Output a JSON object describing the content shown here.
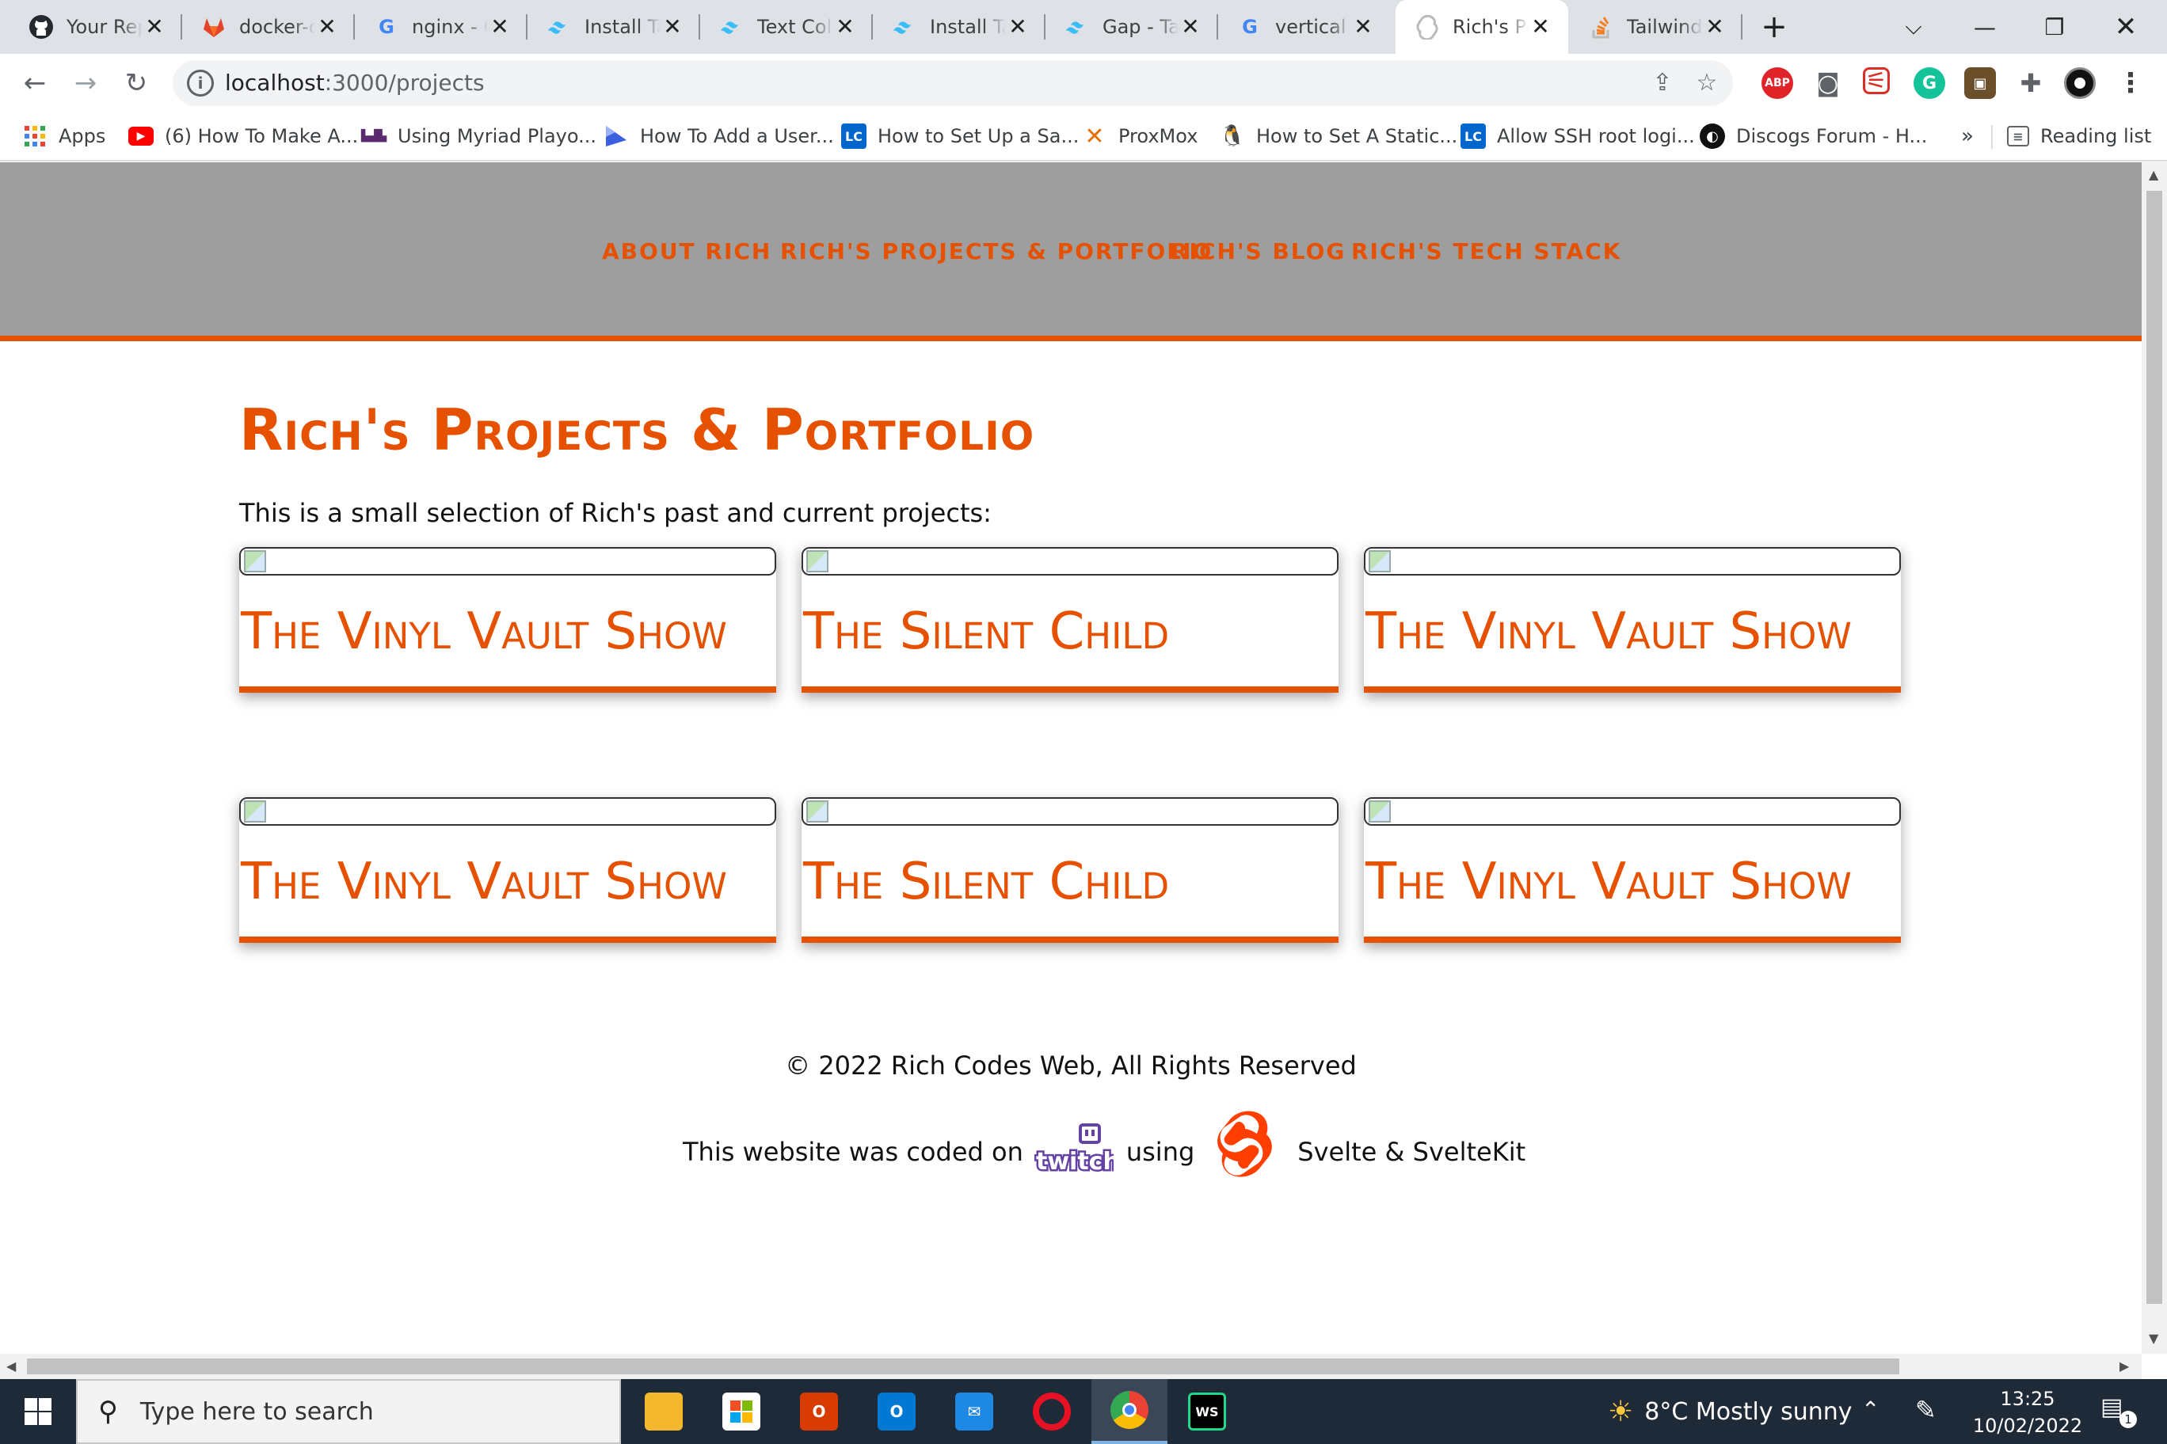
{
  "tabs": [
    {
      "title": "Your Repositories",
      "icon": "github-icon"
    },
    {
      "title": "docker-compose",
      "icon": "gitlab-icon"
    },
    {
      "title": "nginx - Google Search",
      "icon": "google-icon"
    },
    {
      "title": "Install Tailwind CSS",
      "icon": "tailwind-icon"
    },
    {
      "title": "Text Color - Tailwind CSS",
      "icon": "tailwind-icon"
    },
    {
      "title": "Install Tailwind CSS",
      "icon": "tailwind-icon"
    },
    {
      "title": "Gap - Tailwind CSS",
      "icon": "tailwind-icon"
    },
    {
      "title": "vertical align",
      "icon": "google-icon"
    },
    {
      "title": "Rich's Projects",
      "icon": "svelte-icon"
    },
    {
      "title": "Tailwind",
      "icon": "stackoverflow-icon"
    }
  ],
  "url": {
    "host": "localhost",
    "path": ":3000/projects"
  },
  "bookmarks": [
    {
      "label": "Apps",
      "icon": "apps-grid-icon"
    },
    {
      "label": "(6) How To Make A...",
      "icon": "youtube-icon"
    },
    {
      "label": "Using Myriad Playo...",
      "icon": "myriad-icon"
    },
    {
      "label": "How To Add a User...",
      "icon": "linode-icon"
    },
    {
      "label": "How to Set Up a Sa...",
      "icon": "lc-icon"
    },
    {
      "label": "ProxMox",
      "icon": "proxmox-icon"
    },
    {
      "label": "How to Set A Static...",
      "icon": "linux-icon"
    },
    {
      "label": "Allow SSH root logi...",
      "icon": "lc-icon"
    },
    {
      "label": "Discogs Forum - H...",
      "icon": "discogs-icon"
    }
  ],
  "bookmarks_overflow": "»",
  "reading_list": "Reading list",
  "site_nav": [
    "ABOUT RICH",
    "RICH'S PROJECTS & PORTFOLIO",
    "RICH'S BLOG",
    "RICH'S TECH STACK"
  ],
  "page": {
    "title": "Rich's Projects & Portfolio",
    "intro": "This is a small selection of Rich's past and current projects:"
  },
  "projects": [
    {
      "title": "The Vinyl Vault Show"
    },
    {
      "title": "The Silent Child"
    },
    {
      "title": "The Vinyl Vault Show"
    },
    {
      "title": "The Vinyl Vault Show"
    },
    {
      "title": "The Silent Child"
    },
    {
      "title": "The Vinyl Vault Show"
    }
  ],
  "footer": {
    "copyright": "© 2022 Rich Codes Web, All Rights Reserved",
    "coded_on": "This website was coded on",
    "using": "using",
    "stack": "Svelte & SvelteKit"
  },
  "taskbar": {
    "search_placeholder": "Type here to search",
    "weather": "8°C  Mostly sunny",
    "time": "13:25",
    "date": "10/02/2022",
    "notification_count": "1"
  },
  "colors": {
    "accent": "#e65100",
    "nav_bg": "#9e9e9e"
  }
}
